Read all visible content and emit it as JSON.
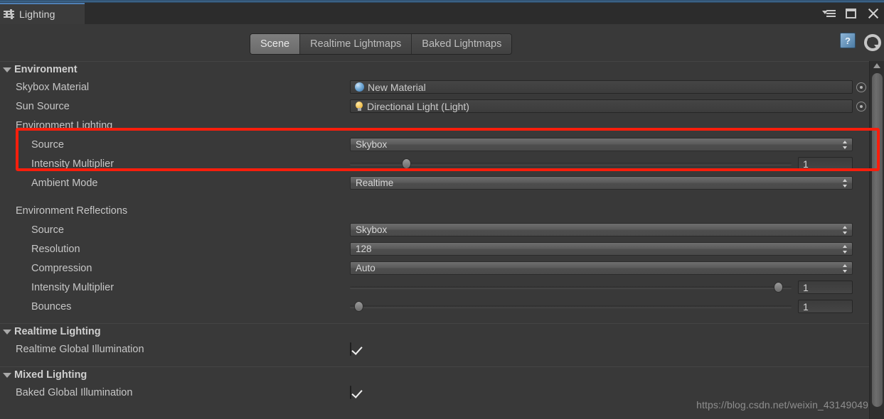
{
  "window": {
    "tab_label": "Lighting",
    "tab_icon": "sliders-icon",
    "controls": {
      "menu": "panel-menu-icon",
      "maximize": "maximize-icon",
      "close": "close-icon"
    }
  },
  "toolbar": {
    "tabs": [
      {
        "label": "Scene",
        "selected": true
      },
      {
        "label": "Realtime Lightmaps",
        "selected": false
      },
      {
        "label": "Baked Lightmaps",
        "selected": false
      }
    ],
    "help_icon": "help-book-icon",
    "help_glyph": "?",
    "gear_icon": "gear-icon"
  },
  "sections": {
    "environment": {
      "title": "Environment",
      "skybox_material": {
        "label": "Skybox Material",
        "value": "New Material",
        "icon": "material-sphere-icon"
      },
      "sun_source": {
        "label": "Sun Source",
        "value": "Directional Light (Light)",
        "icon": "light-bulb-icon"
      },
      "environment_lighting": {
        "group_label": "Environment Lighting",
        "source": {
          "label": "Source",
          "value": "Skybox"
        },
        "intensity_multiplier": {
          "label": "Intensity Multiplier",
          "value": "1",
          "slider_percent": 12
        },
        "ambient_mode": {
          "label": "Ambient Mode",
          "value": "Realtime"
        }
      },
      "environment_reflections": {
        "group_label": "Environment Reflections",
        "source": {
          "label": "Source",
          "value": "Skybox"
        },
        "resolution": {
          "label": "Resolution",
          "value": "128"
        },
        "compression": {
          "label": "Compression",
          "value": "Auto"
        },
        "intensity_multiplier": {
          "label": "Intensity Multiplier",
          "value": "1",
          "slider_percent": 98
        },
        "bounces": {
          "label": "Bounces",
          "value": "1",
          "slider_percent": 1
        }
      }
    },
    "realtime_lighting": {
      "title": "Realtime Lighting",
      "realtime_gi": {
        "label": "Realtime Global Illumination",
        "checked": true
      }
    },
    "mixed_lighting": {
      "title": "Mixed Lighting",
      "baked_gi": {
        "label": "Baked Global Illumination",
        "checked": true
      }
    }
  },
  "annotation": {
    "highlight_color": "#f81e0c",
    "target": "environment-lighting-source"
  },
  "watermark": "https://blog.csdn.net/weixin_43149049",
  "colors": {
    "background": "#393939",
    "titlebar": "#2c2c2c",
    "accent_blue": "#4f7fb5",
    "text": "#c6c6c6"
  }
}
